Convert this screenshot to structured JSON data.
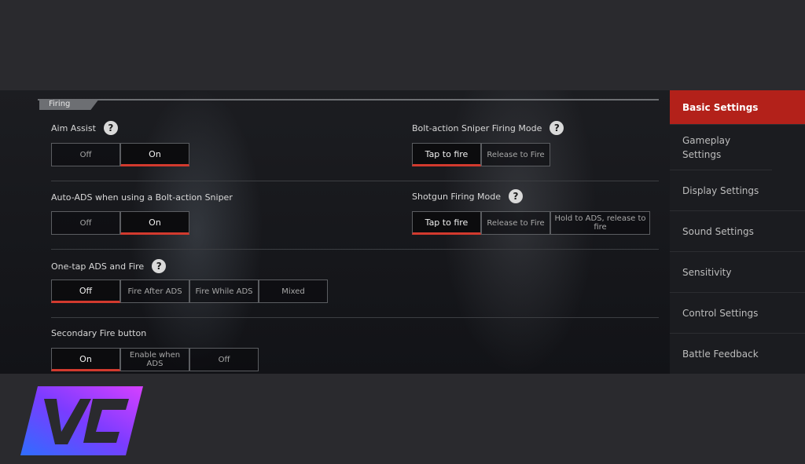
{
  "section": {
    "title": "Firing"
  },
  "settings": {
    "aim_assist": {
      "label": "Aim Assist",
      "options": [
        "Off",
        "On"
      ],
      "selected": "On"
    },
    "bolt_sniper_mode": {
      "label": "Bolt-action Sniper Firing Mode",
      "options": [
        "Tap to fire",
        "Release to Fire"
      ],
      "selected": "Tap to fire"
    },
    "auto_ads": {
      "label": "Auto-ADS when using a Bolt-action Sniper",
      "options": [
        "Off",
        "On"
      ],
      "selected": "On"
    },
    "shotgun_mode": {
      "label": "Shotgun Firing Mode",
      "options": [
        "Tap to fire",
        "Release to Fire",
        "Hold to ADS, release to fire"
      ],
      "selected": "Tap to fire"
    },
    "one_tap_ads": {
      "label": "One-tap ADS and Fire",
      "options": [
        "Off",
        "Fire After ADS",
        "Fire While ADS",
        "Mixed"
      ],
      "selected": "Off"
    },
    "secondary_fire": {
      "label": "Secondary Fire button",
      "options": [
        "On",
        "Enable when ADS",
        "Off"
      ],
      "selected": "On"
    }
  },
  "help_glyph": "?",
  "sidebar": {
    "items": [
      {
        "label": "Basic Settings",
        "active": true
      },
      {
        "label": "Gameplay Settings",
        "active": false
      },
      {
        "label": "Display Settings",
        "active": false
      },
      {
        "label": "Sound Settings",
        "active": false
      },
      {
        "label": "Sensitivity",
        "active": false
      },
      {
        "label": "Control Settings",
        "active": false
      },
      {
        "label": "Battle Feedback",
        "active": false
      }
    ]
  },
  "colors": {
    "accent": "#d23a2e",
    "sidebar_active": "#b3211a",
    "background": "#2a2a2e"
  },
  "logo": {
    "text": "VC",
    "icon": "vc-logo-icon"
  }
}
